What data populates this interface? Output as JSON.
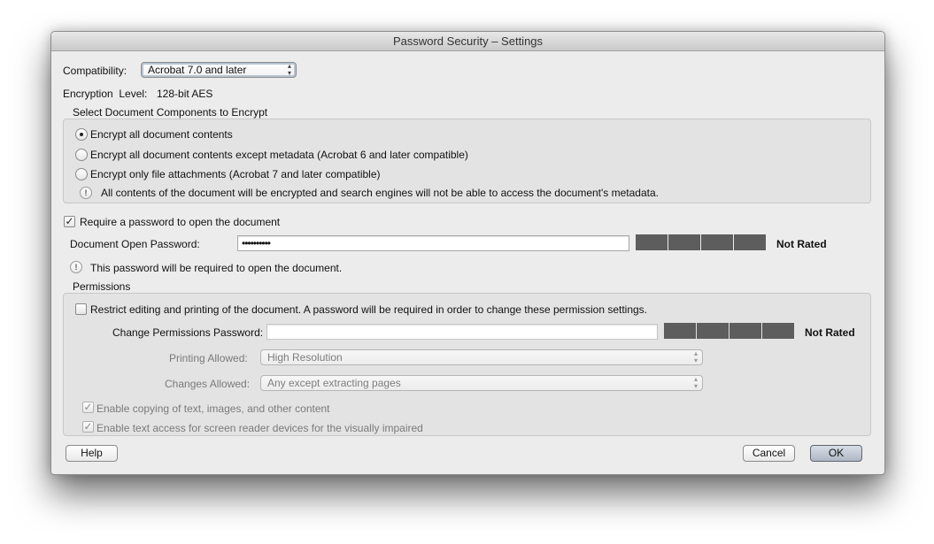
{
  "window": {
    "title": "Password Security – Settings"
  },
  "compatibility": {
    "label": "Compatibility:",
    "selected": "Acrobat 7.0 and later"
  },
  "encryption_level": {
    "label": "Encryption  Level:",
    "value": "128-bit AES"
  },
  "components": {
    "group_title": "Select Document Components to Encrypt",
    "options": [
      {
        "label": "Encrypt all document contents",
        "selected": true
      },
      {
        "label": "Encrypt all document contents except metadata (Acrobat 6 and later compatible)",
        "selected": false
      },
      {
        "label": "Encrypt only file attachments (Acrobat 7 and later compatible)",
        "selected": false
      }
    ],
    "info": "All contents of the document will be encrypted and search engines will not be able to access the document's metadata."
  },
  "open_password": {
    "require_label": "Require a password to open the document",
    "require_checked": true,
    "field_label": "Document Open Password:",
    "value": "••••••••••",
    "rating": "Not Rated",
    "info": "This password will be required to open the document."
  },
  "permissions": {
    "group_title": "Permissions",
    "restrict_label": "Restrict editing and printing of the document. A password will be required in order to change these permission settings.",
    "restrict_checked": false,
    "password_label": "Change Permissions Password:",
    "password_value": "",
    "rating": "Not Rated",
    "printing_label": "Printing Allowed:",
    "printing_value": "High Resolution",
    "changes_label": "Changes Allowed:",
    "changes_value": "Any except extracting pages",
    "copy_label": "Enable copying of text, images, and other content",
    "copy_checked": true,
    "screen_reader_label": "Enable text access for screen reader devices for the visually impaired",
    "screen_reader_checked": true
  },
  "buttons": {
    "help": "Help",
    "cancel": "Cancel",
    "ok": "OK"
  },
  "icons": {
    "popup_arrows": "▴▾",
    "check": "✓",
    "info": "!"
  }
}
